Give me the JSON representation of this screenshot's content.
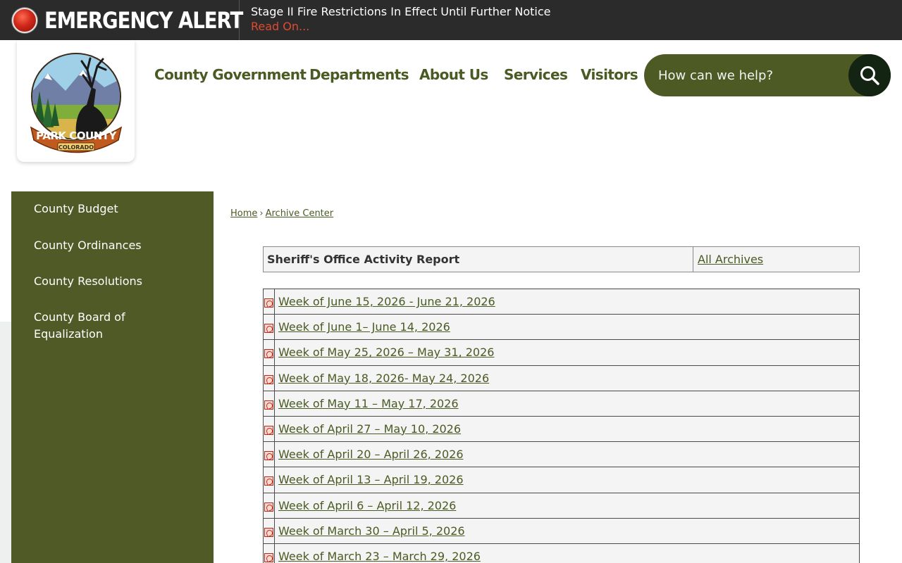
{
  "alert": {
    "title": "EMERGENCY ALERT",
    "message": "Stage II Fire Restrictions In Effect Until Further Notice",
    "link": "Read On..."
  },
  "logo": {
    "name": "PARK COUNTY",
    "state": "COLORADO"
  },
  "nav": {
    "items": [
      "County Government",
      "Departments",
      "About Us",
      "Services",
      "Visitors"
    ]
  },
  "search": {
    "placeholder": "How can we help?"
  },
  "sidebar": {
    "items": [
      "County Budget",
      "County Ordinances",
      "County Resolutions",
      "County Board of Equalization"
    ]
  },
  "breadcrumb": {
    "home": "Home",
    "separator": "›",
    "current": "Archive Center"
  },
  "archive": {
    "title": "Sheriff's Office Activity Report",
    "all_link": "All Archives",
    "rows": [
      "Week of June 15, 2026 - June 21, 2026",
      "Week of June 1– June 14, 2026",
      "Week of May 25, 2026 – May 31, 2026",
      "Week of May 18, 2026- May 24, 2026",
      "Week of May 11 – May 17, 2026",
      "Week of April 27 – May 10, 2026",
      "Week of April 20 – April 26, 2026",
      "Week of April 13 – April 19, 2026",
      "Week of April 6 – April 12, 2026",
      "Week of March 30 – April 5, 2026",
      "Week of March 23 – March 29, 2026"
    ]
  },
  "colors": {
    "brand_olive": "#4f5a26",
    "search_button": "#142413",
    "alert_bar": "#2b2b2b",
    "alert_link": "#e04a2f"
  }
}
